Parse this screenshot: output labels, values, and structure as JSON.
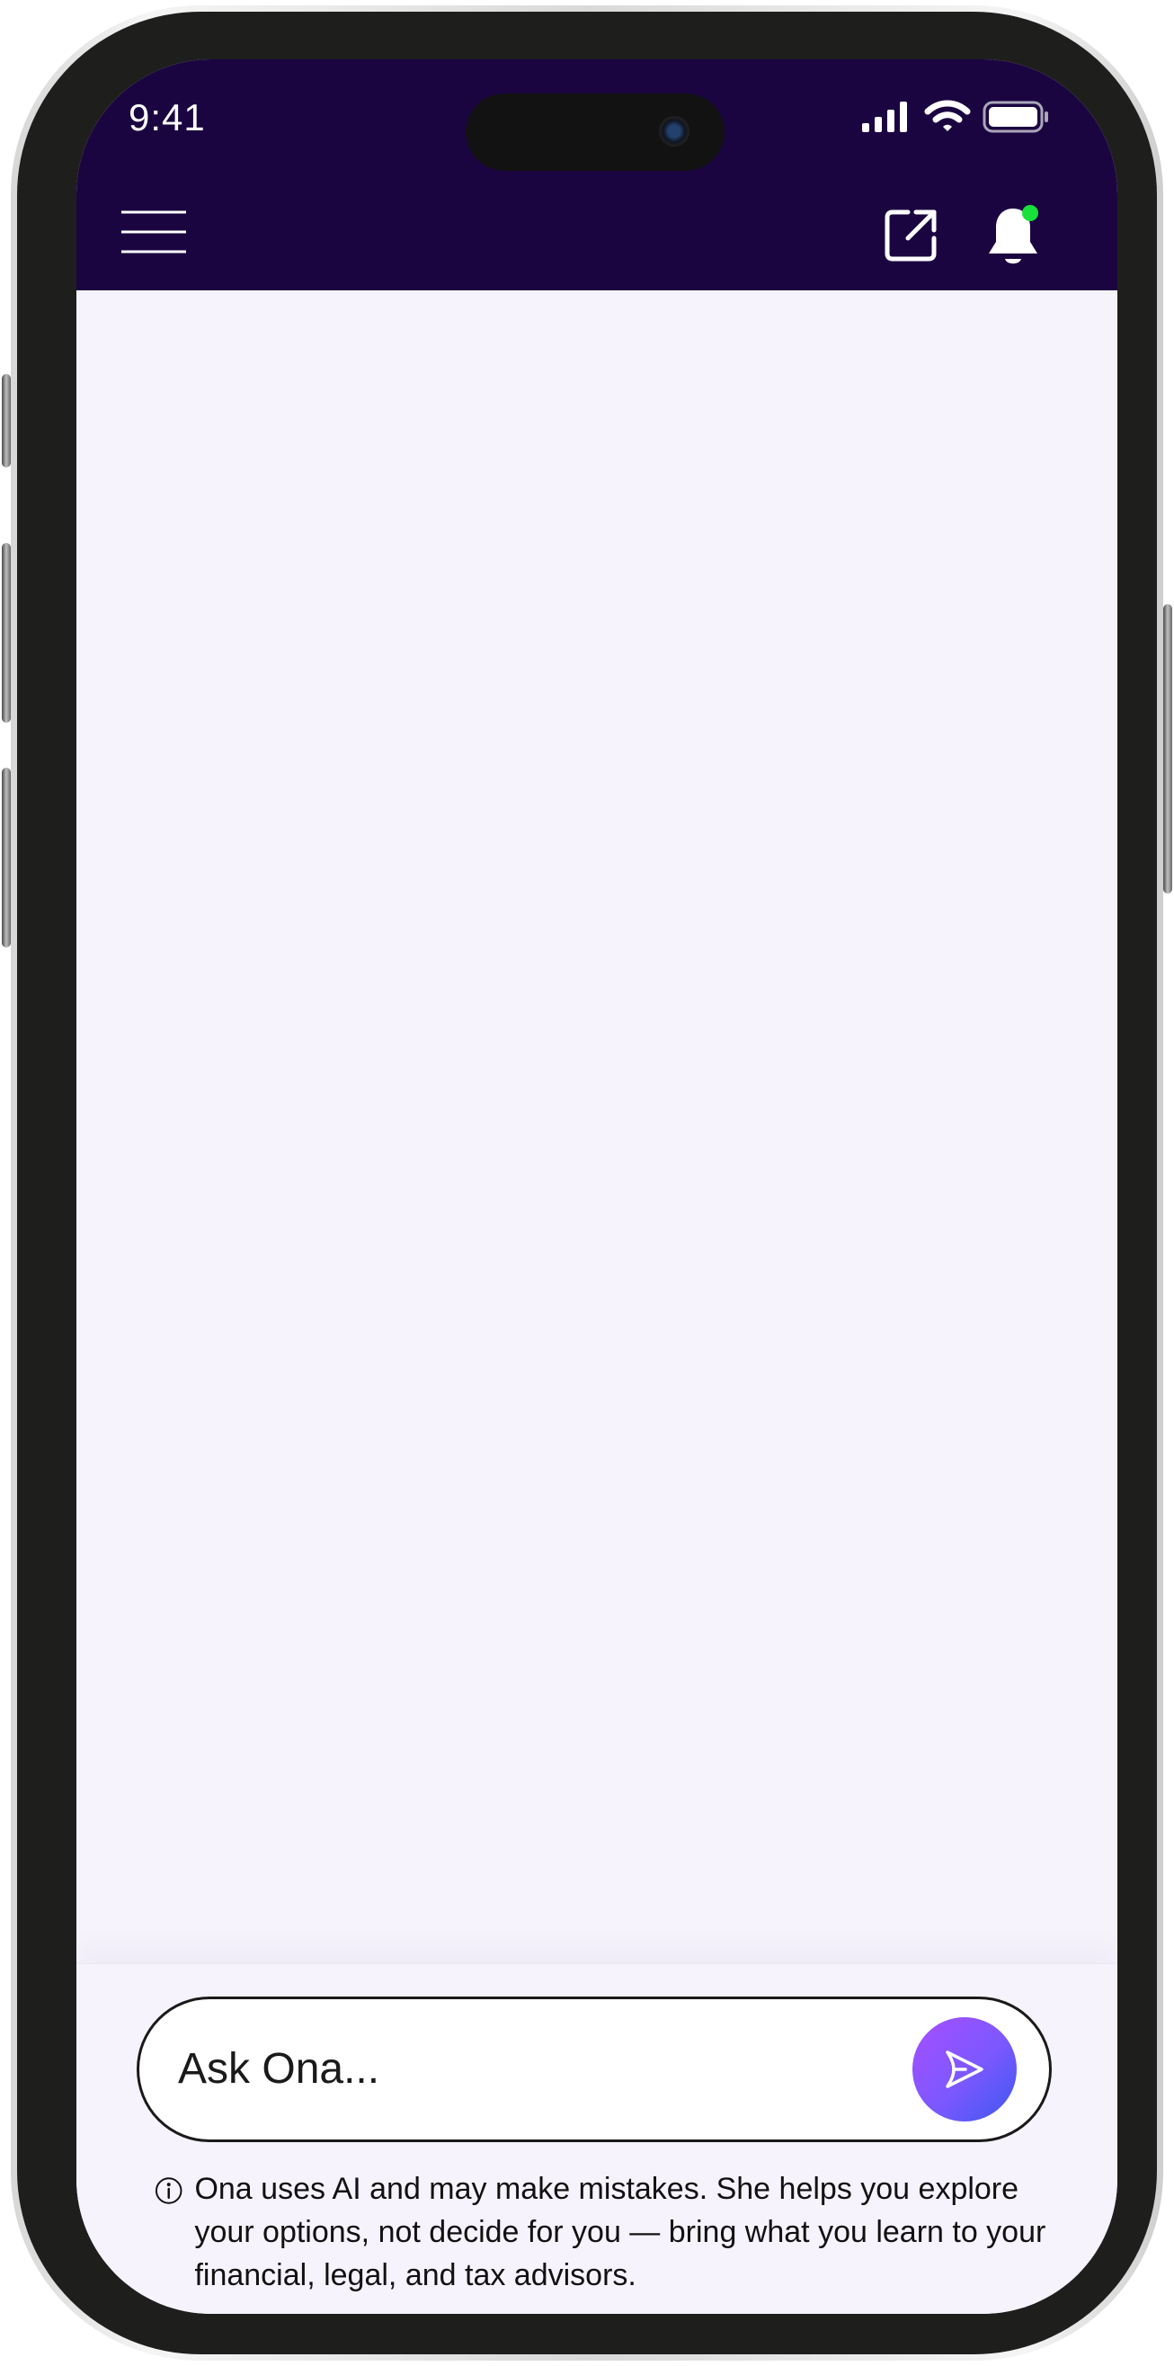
{
  "status_bar": {
    "time": "9:41"
  },
  "header": {
    "menu_icon": "hamburger-menu-icon",
    "share_icon": "external-link-icon",
    "notifications_icon": "bell-icon",
    "notification_dot_color": "#18e13b",
    "background_color": "#1b0541"
  },
  "chat": {
    "placeholder": "Ask Ona...",
    "send_icon": "send-arrow-icon"
  },
  "disclaimer": {
    "info_icon": "info-icon",
    "text": "Ona uses AI and may make mistakes. She helps you explore your options, not decide for you — bring what you learn to your financial, legal, and tax advisors."
  }
}
